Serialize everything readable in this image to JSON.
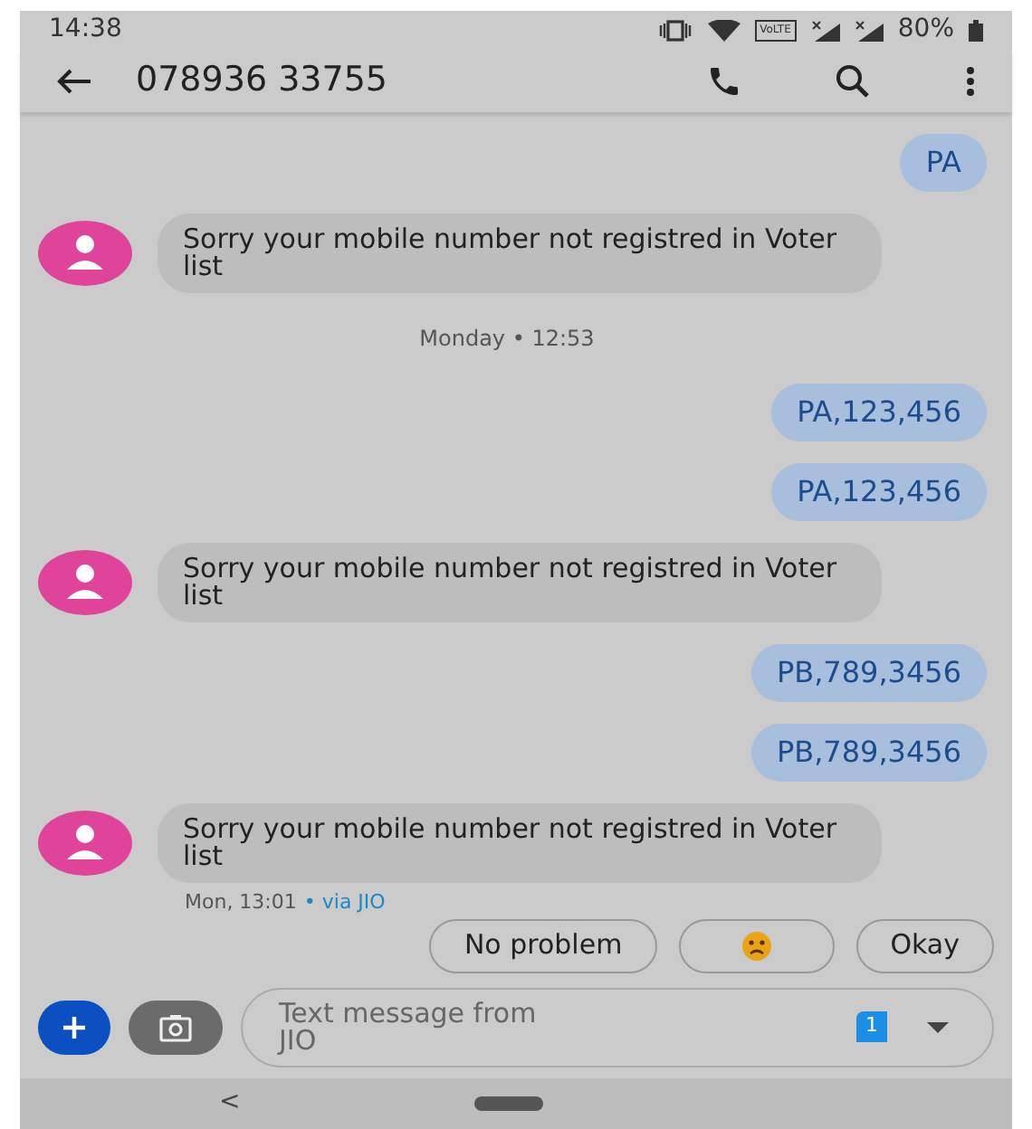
{
  "status_bar": {
    "time": "14:38",
    "volte": "VoLTE",
    "battery": "80%"
  },
  "header": {
    "title": "078936 33755"
  },
  "messages": [
    {
      "kind": "outgoing",
      "text": "PA"
    },
    {
      "kind": "incoming",
      "text": "Sorry your mobile number not registred in Voter list"
    },
    {
      "kind": "date",
      "text": "Monday • 12:53"
    },
    {
      "kind": "outgoing",
      "text": "PA,123,456"
    },
    {
      "kind": "outgoing",
      "text": "PA,123,456"
    },
    {
      "kind": "incoming",
      "text": "Sorry your mobile number not registred in Voter list"
    },
    {
      "kind": "outgoing",
      "text": "PB,789,3456"
    },
    {
      "kind": "outgoing",
      "text": "PB,789,3456"
    },
    {
      "kind": "incoming",
      "text": "Sorry your mobile number not registred in Voter list",
      "time": "Mon, 13:01",
      "via": "• via JIO"
    }
  ],
  "suggestions": [
    {
      "kind": "text",
      "label": "No problem"
    },
    {
      "kind": "emoji"
    },
    {
      "kind": "text",
      "label": "Okay"
    }
  ],
  "compose": {
    "placeholder": "Text message from JIO",
    "sim": "1"
  },
  "nav_bar": {
    "back": "<"
  }
}
